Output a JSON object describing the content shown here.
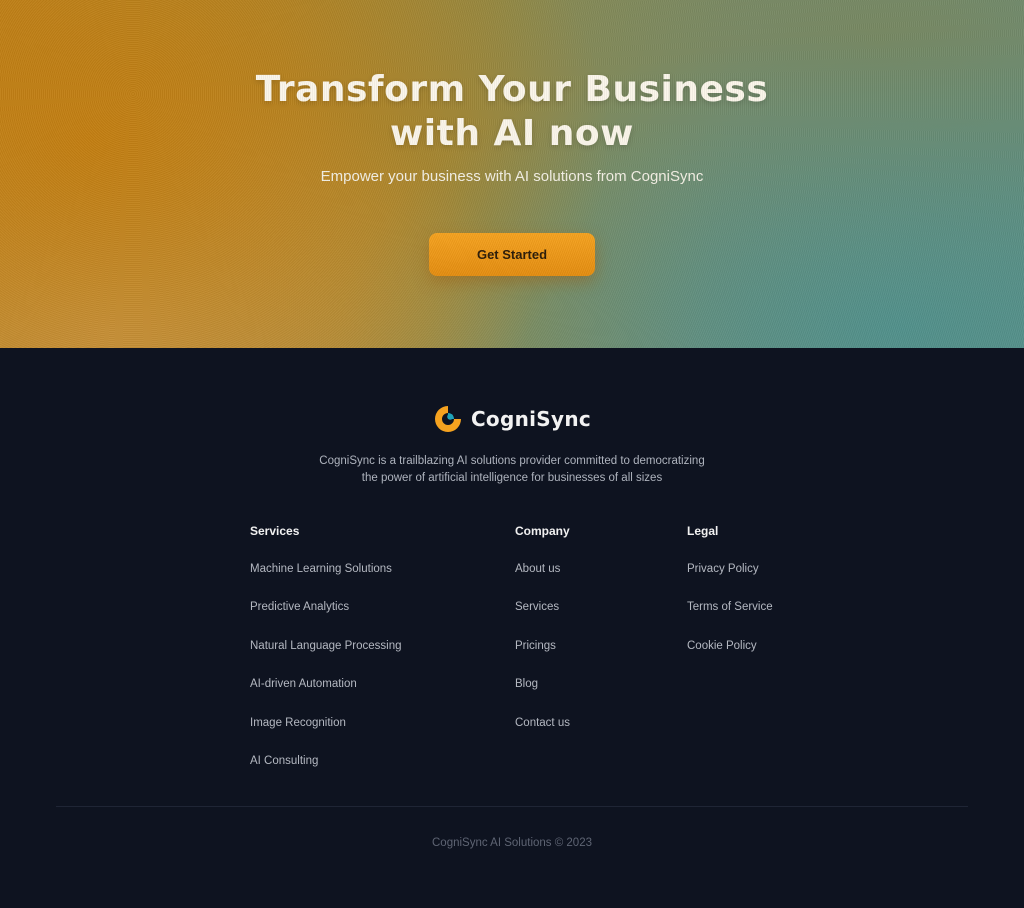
{
  "hero": {
    "title_line1": "Transform Your Business",
    "title_line2": "with AI now",
    "subtitle": "Empower your business with AI solutions from CogniSync",
    "cta_label": "Get Started"
  },
  "brand": {
    "name": "CogniSync",
    "logo_icon": "cognisync-logo-icon",
    "description_line1": "CogniSync is a trailblazing AI solutions provider committed to democratizing",
    "description_line2": "the power of artificial intelligence for businesses of all sizes"
  },
  "footer": {
    "columns": [
      {
        "heading": "Services",
        "links": [
          "Machine Learning Solutions",
          "Predictive Analytics",
          "Natural Language Processing",
          "AI-driven Automation",
          "Image Recognition",
          "AI Consulting"
        ]
      },
      {
        "heading": "Company",
        "links": [
          "About us",
          "Services",
          "Pricings",
          "Blog",
          "Contact us"
        ]
      },
      {
        "heading": "Legal",
        "links": [
          "Privacy Policy",
          "Terms of Service",
          "Cookie Policy"
        ]
      }
    ],
    "copyright": "CogniSync AI Solutions © 2023"
  },
  "colors": {
    "accent": "#F29A1A",
    "footer_bg": "#0E1320",
    "logo_orange": "#F5A21F",
    "logo_teal": "#1FA3B8"
  }
}
